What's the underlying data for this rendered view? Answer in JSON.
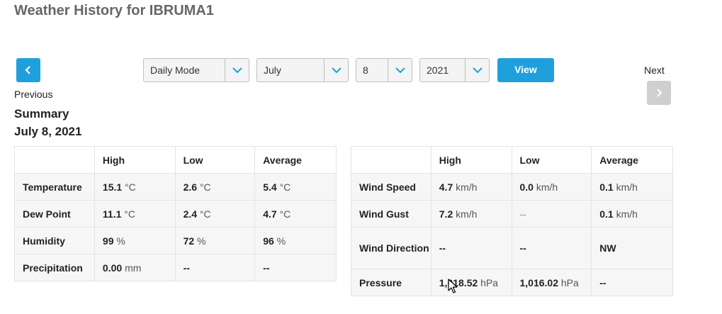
{
  "header": {
    "title": "Weather History for IBRUMA1"
  },
  "nav": {
    "previous_label": "Previous",
    "next_label": "Next",
    "prev_icon": "chevron-left-icon",
    "next_icon": "chevron-right-icon"
  },
  "filters": {
    "mode": "Daily Mode",
    "month": "July",
    "day": "8",
    "year": "2021",
    "view_label": "View"
  },
  "summary": {
    "title": "Summary",
    "date": "July 8, 2021"
  },
  "left_table": {
    "headers": [
      "",
      "High",
      "Low",
      "Average"
    ],
    "rows": [
      {
        "label": "Temperature",
        "high": "15.1",
        "high_unit": "°C",
        "low": "2.6",
        "low_unit": "°C",
        "avg": "5.4",
        "avg_unit": "°C"
      },
      {
        "label": "Dew Point",
        "high": "11.1",
        "high_unit": "°C",
        "low": "2.4",
        "low_unit": "°C",
        "avg": "4.7",
        "avg_unit": "°C"
      },
      {
        "label": "Humidity",
        "high": "99",
        "high_unit": "%",
        "low": "72",
        "low_unit": "%",
        "avg": "96",
        "avg_unit": "%"
      },
      {
        "label": "Precipitation",
        "high": "0.00",
        "high_unit": "mm",
        "low": "--",
        "avg": "--"
      }
    ]
  },
  "right_table": {
    "headers": [
      "",
      "High",
      "Low",
      "Average"
    ],
    "rows": [
      {
        "label": "Wind Speed",
        "high": "4.7",
        "high_unit": "km/h",
        "low": "0.0",
        "low_unit": "km/h",
        "avg": "0.1",
        "avg_unit": "km/h"
      },
      {
        "label": "Wind Gust",
        "high": "7.2",
        "high_unit": "km/h",
        "low": "--",
        "avg": "0.1",
        "avg_unit": "km/h"
      },
      {
        "label": "Wind Direction",
        "high": "--",
        "low": "--",
        "avg": "NW"
      },
      {
        "label": "Pressure",
        "high": "1,018.52",
        "high_unit": "hPa",
        "low": "1,016.02",
        "low_unit": "hPa",
        "avg": "--"
      }
    ]
  },
  "colors": {
    "accent": "#1fa0dc",
    "disabled": "#cfcfcf",
    "title": "#666666"
  }
}
